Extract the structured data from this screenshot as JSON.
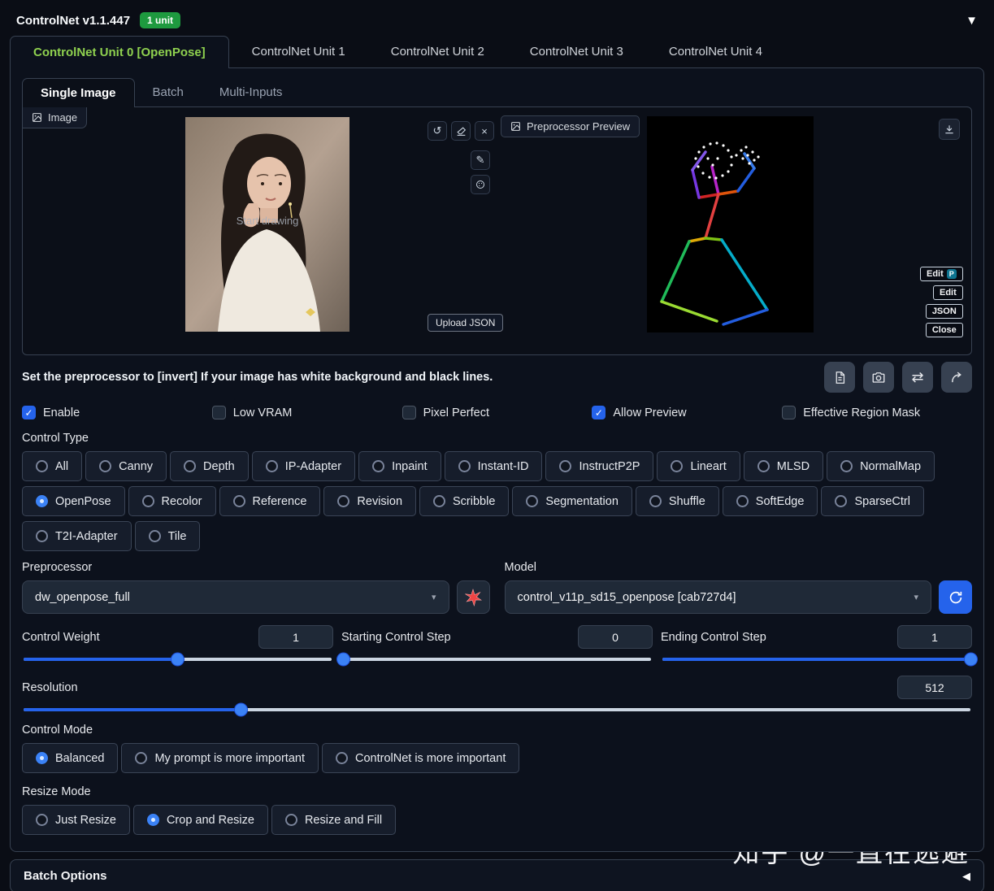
{
  "colors": {
    "accent_blue": "#2563eb",
    "slider_blue": "#3b82f6",
    "active_tab_green": "#8fd14f",
    "badge_green": "#1e9a3f"
  },
  "header": {
    "title": "ControlNet v1.1.447",
    "badge": "1 unit"
  },
  "unit_tabs": [
    {
      "label": "ControlNet Unit 0 [OpenPose]",
      "active": true
    },
    {
      "label": "ControlNet Unit 1",
      "active": false
    },
    {
      "label": "ControlNet Unit 2",
      "active": false
    },
    {
      "label": "ControlNet Unit 3",
      "active": false
    },
    {
      "label": "ControlNet Unit 4",
      "active": false
    }
  ],
  "input_tabs": [
    {
      "label": "Single Image",
      "active": true
    },
    {
      "label": "Batch",
      "active": false
    },
    {
      "label": "Multi-Inputs",
      "active": false
    }
  ],
  "image_panel": {
    "image_label": "Image",
    "start_drawing_hint": "Start drawing",
    "upload_json_button": "Upload JSON",
    "preview_label": "Preprocessor Preview",
    "edit_buttons": [
      "Edit",
      "Edit",
      "JSON",
      "Close"
    ]
  },
  "note": "Set the preprocessor to [invert] If your image has white background and black lines.",
  "options": [
    {
      "label": "Enable",
      "checked": true
    },
    {
      "label": "Low VRAM",
      "checked": false
    },
    {
      "label": "Pixel Perfect",
      "checked": false
    },
    {
      "label": "Allow Preview",
      "checked": true
    },
    {
      "label": "Effective Region Mask",
      "checked": false
    }
  ],
  "control_type": {
    "label": "Control Type",
    "selected": "OpenPose",
    "rows": [
      [
        "All",
        "Canny",
        "Depth",
        "IP-Adapter",
        "Inpaint",
        "Instant-ID",
        "InstructP2P",
        "Lineart",
        "MLSD",
        "NormalMap"
      ],
      [
        "OpenPose",
        "Recolor",
        "Reference",
        "Revision",
        "Scribble",
        "Segmentation",
        "Shuffle",
        "SoftEdge",
        "SparseCtrl"
      ],
      [
        "T2I-Adapter",
        "Tile"
      ]
    ]
  },
  "preprocessor": {
    "label": "Preprocessor",
    "value": "dw_openpose_full"
  },
  "model": {
    "label": "Model",
    "value": "control_v11p_sd15_openpose [cab727d4]"
  },
  "sliders": {
    "control_weight": {
      "label": "Control Weight",
      "value": "1",
      "percent": 50
    },
    "starting_step": {
      "label": "Starting Control Step",
      "value": "0",
      "percent": 0
    },
    "ending_step": {
      "label": "Ending Control Step",
      "value": "1",
      "percent": 100
    },
    "resolution": {
      "label": "Resolution",
      "value": "512",
      "percent": 23
    }
  },
  "control_mode": {
    "label": "Control Mode",
    "selected": "Balanced",
    "options": [
      "Balanced",
      "My prompt is more important",
      "ControlNet is more important"
    ]
  },
  "resize_mode": {
    "label": "Resize Mode",
    "selected": "Crop and Resize",
    "options": [
      "Just Resize",
      "Crop and Resize",
      "Resize and Fill"
    ]
  },
  "batch_options": {
    "label": "Batch Options"
  },
  "watermark": "知乎 @一直在逃避"
}
